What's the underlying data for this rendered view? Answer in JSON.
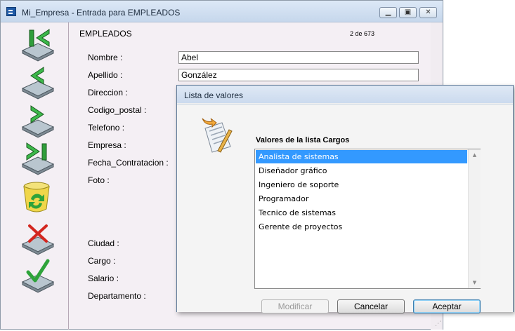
{
  "window": {
    "title": "Mi_Empresa - Entrada para EMPLEADOS",
    "caption_buttons": [
      "minimize",
      "maximize",
      "close"
    ]
  },
  "toolbar": {
    "icons": [
      "first-record-icon",
      "previous-record-icon",
      "next-record-icon",
      "last-record-icon",
      "refresh-icon",
      "delete-record-icon",
      "save-record-icon"
    ]
  },
  "form": {
    "title": "EMPLEADOS",
    "record_count": "2 de 673",
    "labels": {
      "nombre": "Nombre :",
      "apellido": "Apellido :",
      "direccion": "Direccion :",
      "codigo_postal": "Codigo_postal :",
      "telefono": "Telefono :",
      "empresa": "Empresa :",
      "fecha_contratacion": "Fecha_Contratacion :",
      "foto": "Foto :",
      "ciudad": "Ciudad :",
      "cargo": "Cargo :",
      "salario": "Salario :",
      "departamento": "Departamento :"
    },
    "values": {
      "nombre": "Abel",
      "apellido": "González"
    }
  },
  "dialog": {
    "title": "Lista de valores",
    "list_title": "Valores de la lista Cargos",
    "items": [
      "Analista de sistemas",
      "Diseñador gráfico",
      "Ingeniero de soporte",
      "Programador",
      "Tecnico de sistemas",
      "Gerente de proyectos"
    ],
    "selected_index": 0,
    "buttons": {
      "modificar": "Modificar",
      "cancelar": "Cancelar",
      "aceptar": "Aceptar"
    }
  },
  "colors": {
    "selection": "#3399ff",
    "form_bg": "#f4eff4",
    "titlebar": "#cbdaee"
  }
}
